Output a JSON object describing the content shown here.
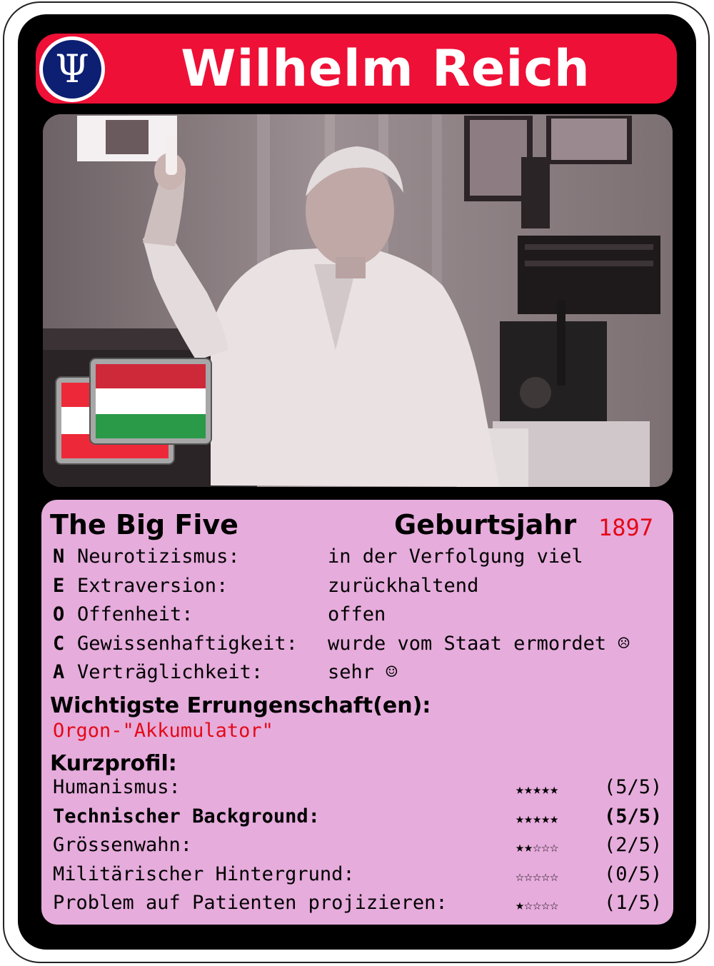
{
  "card": {
    "title": "Wilhelm Reich",
    "logo_symbol": "Ψ",
    "logo_icon": "psi-icon",
    "colors": {
      "title_bar": "#ee1036",
      "logo_bg": "#0c1f73",
      "info_bg": "#e6acdc",
      "accent_red": "#e30a17"
    }
  },
  "flags": [
    {
      "name": "austria-flag-icon",
      "stripes": [
        "#ed2939",
        "#ffffff",
        "#ed2939"
      ]
    },
    {
      "name": "hungary-flag-icon",
      "stripes": [
        "#ce2939",
        "#ffffff",
        "#2a9a48"
      ]
    }
  ],
  "big_five": {
    "heading": "The Big Five",
    "birth_label": "Geburtsjahr",
    "birth_year": "1897",
    "traits": [
      {
        "letter": "N",
        "label": "Neurotizismus:",
        "value": "in der Verfolgung viel"
      },
      {
        "letter": "E",
        "label": "Extraversion:",
        "value": "zurückhaltend"
      },
      {
        "letter": "O",
        "label": "Offenheit:",
        "value": "offen"
      },
      {
        "letter": "C",
        "label": "Gewissenhaftigkeit:",
        "value": "wurde vom Staat ermordet ☹"
      },
      {
        "letter": "A",
        "label": "Verträglichkeit:",
        "value": "sehr ☺"
      }
    ]
  },
  "achievement": {
    "heading": "Wichtigste Errungenschaft(en):",
    "value": "Orgon-\"Akkumulator\""
  },
  "profile": {
    "heading": "Kurzprofil:",
    "rows": [
      {
        "label": "Humanismus:",
        "stars": "★★★★★",
        "score": "(5/5)",
        "bold": false
      },
      {
        "label": "Technischer Background:",
        "stars": "★★★★★",
        "score": "(5/5)",
        "bold": true
      },
      {
        "label": "Grössenwahn:",
        "stars": "★★☆☆☆",
        "score": "(2/5)",
        "bold": false
      },
      {
        "label": "Militärischer Hintergrund:",
        "stars": "☆☆☆☆☆",
        "score": "(0/5)",
        "bold": false
      },
      {
        "label": "Problem auf Patienten projizieren:",
        "stars": "★☆☆☆☆",
        "score": "(1/5)",
        "bold": false
      }
    ]
  }
}
